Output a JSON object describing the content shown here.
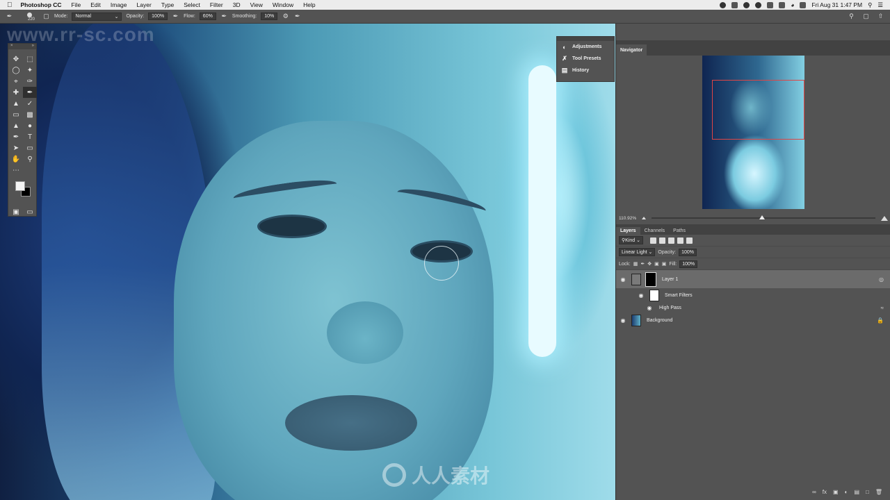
{
  "menubar": {
    "app_name": "Photoshop CC",
    "menus": [
      "File",
      "Edit",
      "Image",
      "Layer",
      "Type",
      "Select",
      "Filter",
      "3D",
      "View",
      "Window",
      "Help"
    ],
    "clock": "Fri Aug 31  1:47 PM"
  },
  "options": {
    "brush_size": "220",
    "mode_label": "Mode:",
    "mode_value": "Normal",
    "opacity_label": "Opacity:",
    "opacity_value": "100%",
    "flow_label": "Flow:",
    "flow_value": "60%",
    "smoothing_label": "Smoothing:",
    "smoothing_value": "10%"
  },
  "canvas": {
    "watermark": "www.rr-sc.com",
    "logo_text": "人人素材"
  },
  "mini_panels": {
    "items": [
      "Adjustments",
      "Tool Presets",
      "History"
    ]
  },
  "navigator": {
    "tab": "Navigator",
    "zoom": "110.92%"
  },
  "layers": {
    "tabs": [
      "Layers",
      "Channels",
      "Paths"
    ],
    "filter_kind": "Kind",
    "blend_mode": "Linear Light",
    "opacity_label": "Opacity:",
    "opacity_value": "100%",
    "lock_label": "Lock:",
    "fill_label": "Fill:",
    "fill_value": "100%",
    "items": [
      {
        "name": "Layer 1"
      },
      {
        "name": "Smart Filters"
      },
      {
        "name": "High Pass"
      },
      {
        "name": "Background"
      }
    ]
  },
  "colors": {
    "foreground": "#f4f4f4",
    "background": "#000000",
    "panel": "#535353",
    "selected_layer": "#6b6b6b"
  }
}
